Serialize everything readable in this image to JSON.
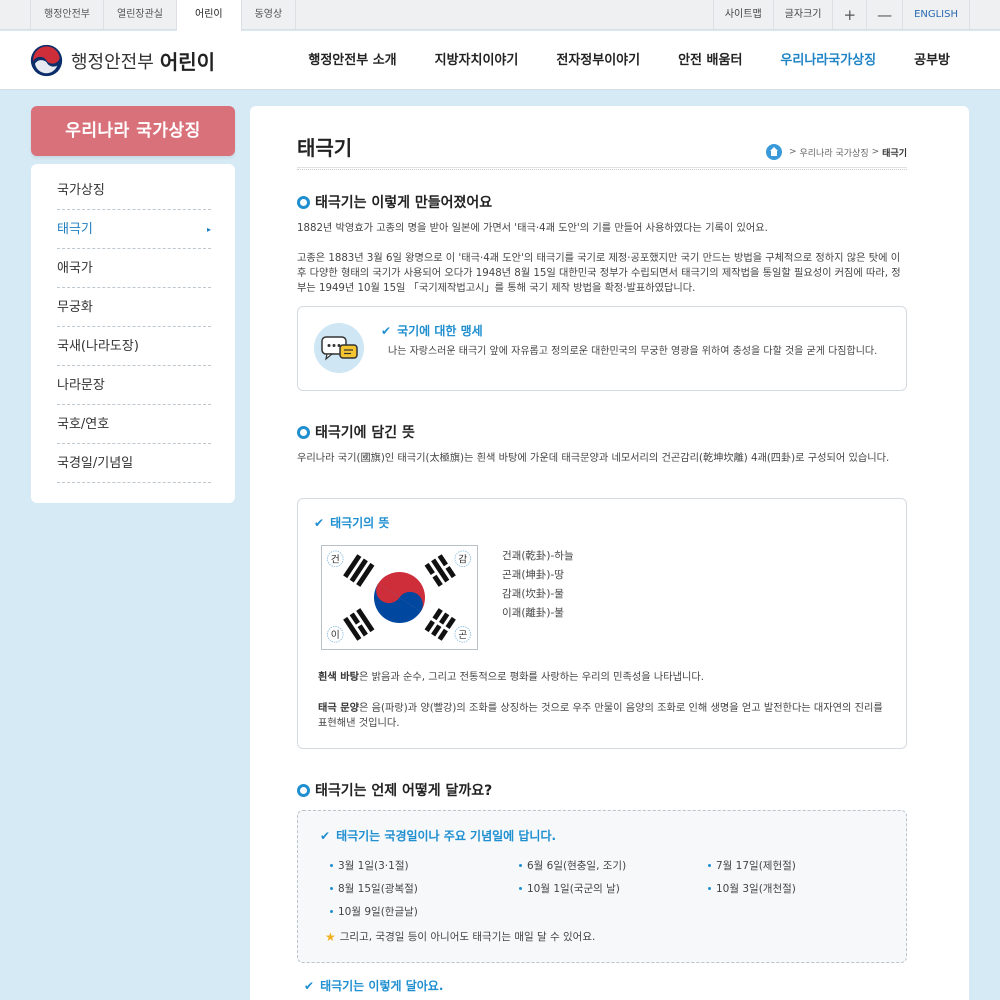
{
  "topbar": {
    "site_tabs": [
      "행정안전부",
      "열린장관실",
      "어린이",
      "동영상"
    ],
    "active_tab_index": 2,
    "utils": {
      "sitemap": "사이트맵",
      "font_size": "글자크기",
      "zoom_in": "+",
      "zoom_out": "—",
      "english": "ENGLISH"
    }
  },
  "header": {
    "logo_org": "행정안전부",
    "logo_sub": "어린이",
    "gnb": [
      "행정안전부 소개",
      "지방자치이야기",
      "전자정부이야기",
      "안전 배움터",
      "우리나라국가상징",
      "공부방"
    ],
    "gnb_active_index": 4
  },
  "sidebar": {
    "title": "우리나라 국가상징",
    "items": [
      "국가상징",
      "태극기",
      "애국가",
      "무궁화",
      "국새(나라도장)",
      "나라문장",
      "국호/연호",
      "국경일/기념일"
    ],
    "active_index": 1,
    "active_marker": "▸"
  },
  "page": {
    "title": "태극기",
    "breadcrumb": {
      "sep1": ">",
      "parent": "우리나라 국가상징",
      "sep2": ">",
      "current": "태극기"
    }
  },
  "section1": {
    "heading": "태극기는 이렇게 만들어졌어요",
    "p1": "1882년 박영효가 고종의 명을 받아 일본에 가면서 '태극·4괘 도안'의 기를 만들어 사용하였다는 기록이 있어요.",
    "p2": "고종은 1883년 3월 6일 왕명으로 이 '태극·4괘 도안'의 태극기를 국기로 제정·공포했지만 국기 만드는 방법을 구체적으로 정하지 않은 탓에 이후 다양한 형태의 국기가 사용되어 오다가 1948년 8월 15일 대한민국 정부가 수립되면서 태극기의 제작법을 통일할 필요성이 커짐에 따라, 정부는 1949년 10월 15일 「국기제작법고시」를 통해 국기 제작 방법을 확정·발표하였답니다.",
    "pledge_title": "국기에 대한 맹세",
    "pledge_text": "나는 자랑스러운 태극기 앞에 자유롭고 정의로운 대한민국의 무궁한 영광을 위하여 충성을 다할 것을 굳게 다짐합니다."
  },
  "section2": {
    "heading": "태극기에 담긴 뜻",
    "p1": "우리나라 국기(國旗)인 태극기(太極旗)는 흰색 바탕에 가운데 태극문양과 네모서리의 건곤감리(乾坤坎離) 4괘(四卦)로 구성되어 있습니다.",
    "box_title": "태극기의 뜻",
    "flag_labels": {
      "tl": "건",
      "tr": "감",
      "bl": "이",
      "br": "곤"
    },
    "flag_colors": {
      "red": "#cd2e3a",
      "blue": "#0047a0",
      "black": "#111111"
    },
    "trigrams": [
      "건괘(乾卦)-하늘",
      "곤괘(坤卦)-땅",
      "감괘(坎卦)-물",
      "이괘(離卦)-불"
    ],
    "white_bold": "흰색 바탕",
    "white_text": "은 밝음과 순수, 그리고 전통적으로 평화를 사랑하는 우리의 민족성을 나타냅니다.",
    "taeguk_bold": "태극 문양",
    "taeguk_text": "은 음(파랑)과 양(빨강)의 조화를 상징하는 것으로 우주 만물이 음양의 조화로 인해 생명을 얻고 발전한다는 대자연의 진리를 표현해낸 것입니다."
  },
  "section3": {
    "heading": "태극기는 언제 어떻게 달까요?",
    "box_title": "태극기는 국경일이나 주요 기념일에 답니다.",
    "days": [
      "3월 1일(3·1절)",
      "6월 6일(현충일, 조기)",
      "7월 17일(제헌절)",
      "8월 15일(광복절)",
      "10월 1일(국군의 날)",
      "10월 3일(개천절)",
      "10월 9일(한글날)"
    ],
    "note": "그리고, 국경일 등이 아니어도 태극기는 매일 달 수 있어요.",
    "next_title": "태극기는 이렇게 달아요."
  }
}
